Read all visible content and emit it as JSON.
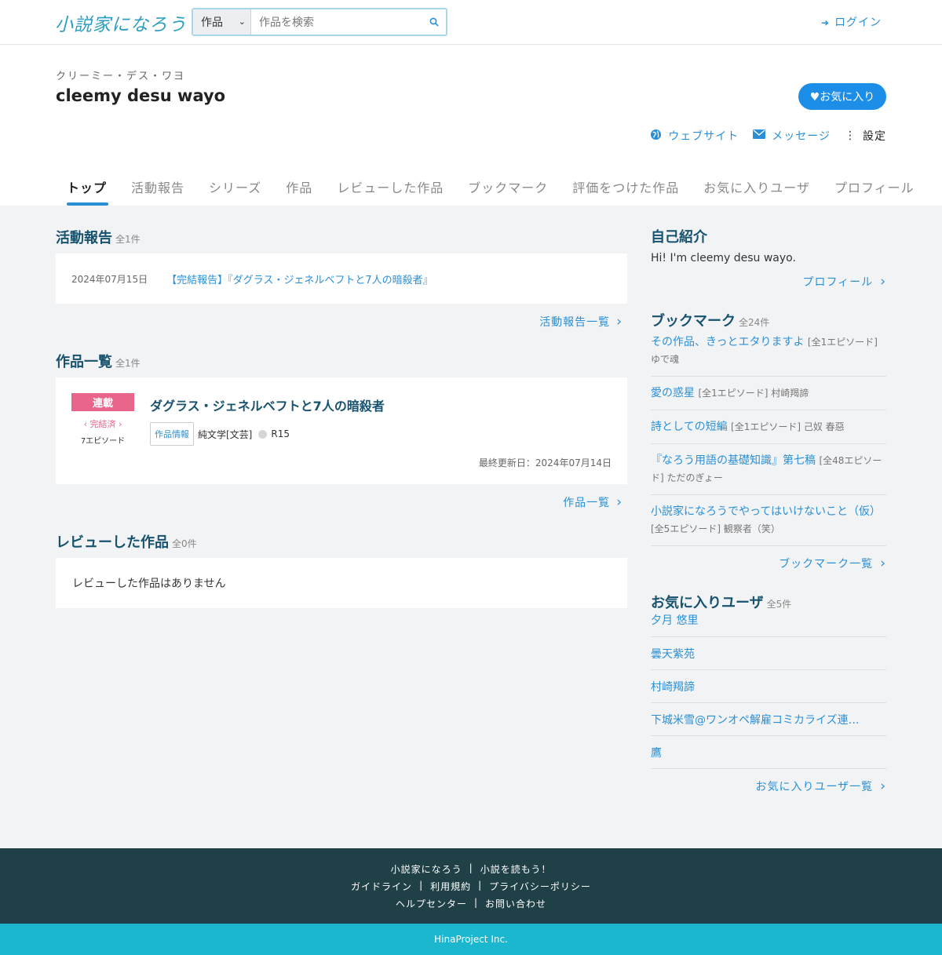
{
  "header": {
    "logo_text": "小説家になろう",
    "search_type": "作品",
    "search_placeholder": "作品を検索",
    "login_label": "ログイン"
  },
  "profile": {
    "kana": "クリーミー・デス・ワヨ",
    "name": "cleemy desu wayo",
    "favorite_button": "♥お気に入り",
    "actions": {
      "website": "ウェブサイト",
      "message": "メッセージ",
      "settings": "設定"
    }
  },
  "tabs": [
    "トップ",
    "活動報告",
    "シリーズ",
    "作品",
    "レビューした作品",
    "ブックマーク",
    "評価をつけた作品",
    "お気に入りユーザ",
    "プロフィール"
  ],
  "activity": {
    "title": "活動報告",
    "count": "全1件",
    "items": [
      {
        "date": "2024年07月15日",
        "title": "【完結報告】『ダグラス・ジェネルベフトと7人の暗殺者』"
      }
    ],
    "more": "活動報告一覧"
  },
  "works": {
    "title": "作品一覧",
    "count": "全1件",
    "items": [
      {
        "status": "連載",
        "completion": "完結済",
        "episodes": "7エピソード",
        "title": "ダグラス・ジェネルベフトと7人の暗殺者",
        "info_label": "作品情報",
        "genre": "純文学[文芸]",
        "rating": "R15",
        "updated": "最終更新日：2024年07月14日"
      }
    ],
    "more": "作品一覧"
  },
  "reviews": {
    "title": "レビューした作品",
    "count": "全0件",
    "empty": "レビューした作品はありません"
  },
  "intro": {
    "title": "自己紹介",
    "text": "Hi! I'm cleemy desu wayo.",
    "more": "プロフィール"
  },
  "bookmarks": {
    "title": "ブックマーク",
    "count": "全24件",
    "items": [
      {
        "title": "その作品、きっとエタりますよ",
        "meta": "[全1エピソード] ゆで魂"
      },
      {
        "title": "愛の惑星",
        "meta": "[全1エピソード] 村崎羯諦"
      },
      {
        "title": "詩としての短編",
        "meta": "[全1エピソード] 己奴 春惡"
      },
      {
        "title": "『なろう用語の基礎知識』第七稿",
        "meta": "[全48エピソード] ただのぎょー"
      },
      {
        "title": "小説家になろうでやってはいけないこと（仮）",
        "meta": "[全5エピソード] 観察者（笑）"
      }
    ],
    "more": "ブックマーク一覧"
  },
  "fav_users": {
    "title": "お気に入りユーザ",
    "count": "全5件",
    "items": [
      "夕月 悠里",
      "曇天紫苑",
      "村崎羯諦",
      "下城米雪@ワンオペ解雇コミカライズ連…",
      "鷹"
    ],
    "more": "お気に入りユーザ一覧"
  },
  "footer": {
    "row1": [
      "小説家になろう",
      "小説を読もう！"
    ],
    "row2": [
      "ガイドライン",
      "利用規約",
      "プライバシーポリシー"
    ],
    "row3": [
      "ヘルプセンター",
      "お問い合わせ"
    ],
    "copyright": "HinaProject Inc."
  },
  "colors": {
    "accent": "#2b8fd6",
    "heading": "#17526e",
    "serial_badge": "#e8648a",
    "footer_bg": "#1f4046",
    "copyright_bg": "#1ab7cf"
  }
}
